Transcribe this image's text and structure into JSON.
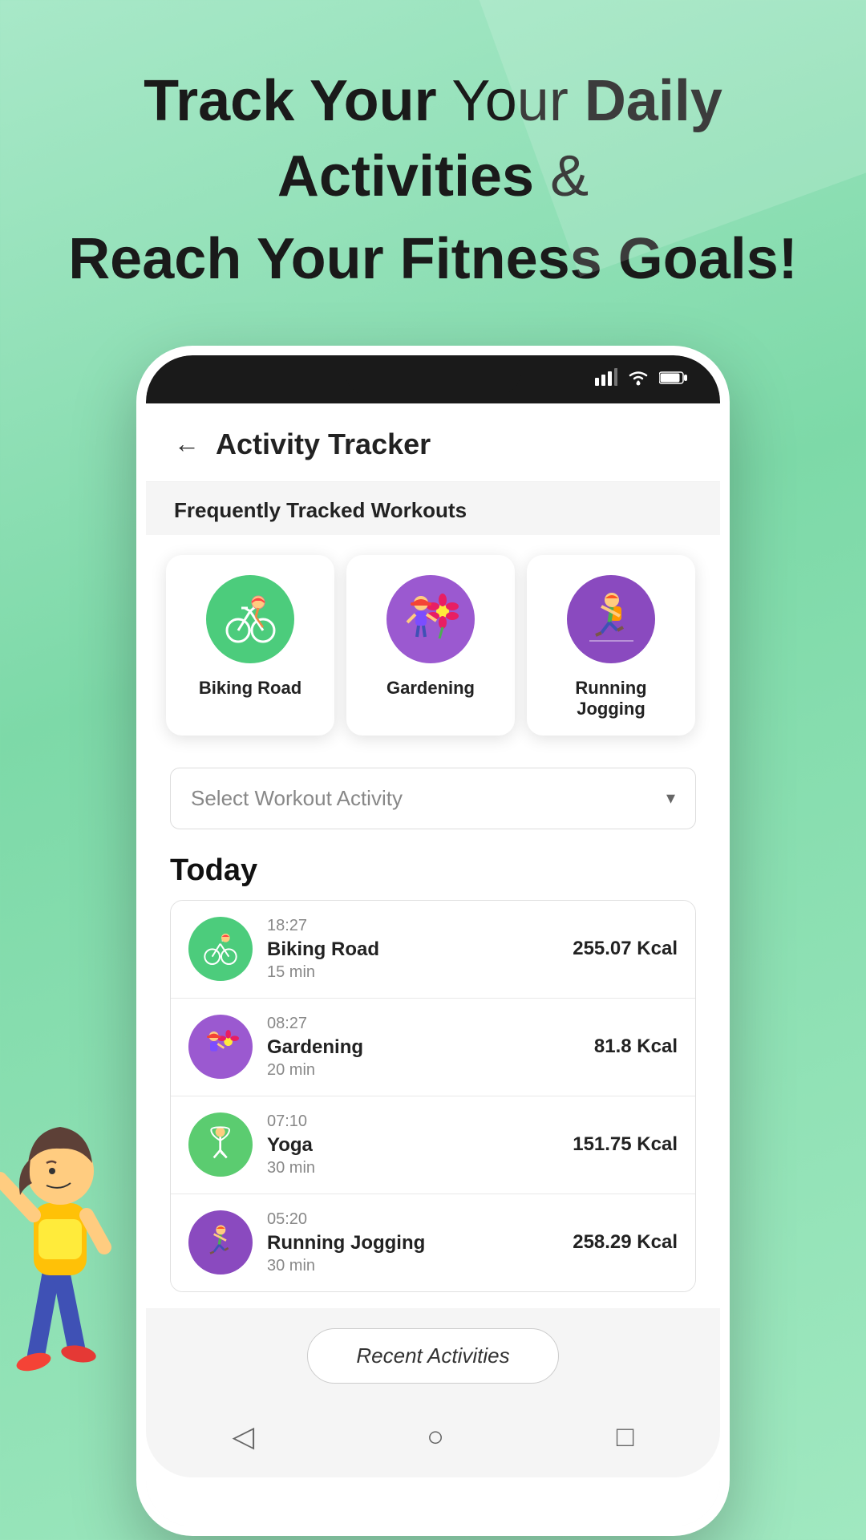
{
  "hero": {
    "line1_normal": "Track Your",
    "line1_bold": "Daily Activities",
    "line1_suffix": " &",
    "line2": "Reach Your Fitness Goals!"
  },
  "phone": {
    "header": {
      "back_label": "←",
      "title": "Activity Tracker"
    },
    "frequently_tracked": {
      "label": "Frequently Tracked Workouts",
      "cards": [
        {
          "id": "biking",
          "label": "Biking Road",
          "emoji": "🚴",
          "color": "green"
        },
        {
          "id": "gardening",
          "label": "Gardening",
          "emoji": "🌸",
          "color": "purple"
        },
        {
          "id": "running",
          "label": "Running Jogging",
          "emoji": "🏃",
          "color": "purple2"
        }
      ]
    },
    "dropdown": {
      "placeholder": "Select Workout Activity",
      "arrow": "▾"
    },
    "today": {
      "header": "Today",
      "activities": [
        {
          "time": "18:27",
          "name": "Biking Road",
          "duration": "15 min",
          "kcal": "255.07 Kcal",
          "emoji": "🚴",
          "color": "green"
        },
        {
          "time": "08:27",
          "name": "Gardening",
          "duration": "20 min",
          "kcal": "81.8 Kcal",
          "emoji": "🌸",
          "color": "purple"
        },
        {
          "time": "07:10",
          "name": "Yoga",
          "duration": "30 min",
          "kcal": "151.75 Kcal",
          "emoji": "🧘",
          "color": "green2"
        },
        {
          "time": "05:20",
          "name": "Running Jogging",
          "duration": "30 min",
          "kcal": "258.29 Kcal",
          "emoji": "🏃",
          "color": "purple2"
        }
      ]
    },
    "recent_activities_btn": "Recent Activities",
    "bottom_nav": {
      "back": "◁",
      "home": "○",
      "square": "□"
    }
  }
}
